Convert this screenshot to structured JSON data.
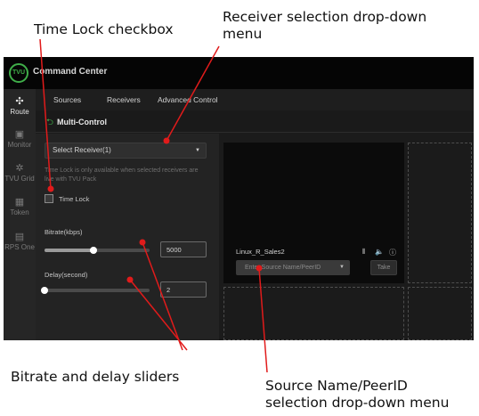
{
  "callouts": {
    "time_lock": "Time Lock checkbox",
    "receiver_line1": "Receiver selection drop-down",
    "receiver_line2": "menu",
    "sliders": "Bitrate and delay sliders",
    "source_line1": "Source Name/PeerID",
    "source_line2": "selection drop-down menu"
  },
  "app": {
    "logo_text": "TVU",
    "title": "Command Center"
  },
  "sidebar": {
    "items": [
      {
        "label": "Route",
        "icon": "route-icon",
        "glyph": "✣",
        "active": true
      },
      {
        "label": "Monitor",
        "icon": "monitor-icon",
        "glyph": "▣",
        "active": false
      },
      {
        "label": "TVU Grid",
        "icon": "grid-icon",
        "glyph": "✲",
        "active": false
      },
      {
        "label": "Token",
        "icon": "qr-icon",
        "glyph": "▦",
        "active": false
      },
      {
        "label": "RPS One",
        "icon": "rps-icon",
        "glyph": "▤",
        "active": false
      }
    ]
  },
  "tabs": [
    "Sources",
    "Receivers",
    "Advanced Control"
  ],
  "header": {
    "back_glyph": "⮌",
    "title": "Multi-Control"
  },
  "panel": {
    "receiver_select": "Select Receiver(1)",
    "caret_glyph": "▼",
    "hint": "Time Lock is only available when selected receivers are live with TVU Pack",
    "time_lock_label": "Time Lock",
    "time_lock_checked": false,
    "bitrate_label": "Bitrate(kbps)",
    "bitrate_value": "5000",
    "bitrate_fraction": 0.47,
    "delay_label": "Delay(second)",
    "delay_value": "2",
    "delay_fraction": 0.0
  },
  "preview": {
    "source_name": "Linux_R_Sales2",
    "source_placeholder": "Enter Source Name/PeerID",
    "take_label": "Take",
    "levels_glyph": "⫴",
    "volume_glyph": "🔈",
    "info_glyph": "ⓘ"
  },
  "colors": {
    "accent": "#3fae49",
    "annotation_arrow": "#e11b1b"
  }
}
